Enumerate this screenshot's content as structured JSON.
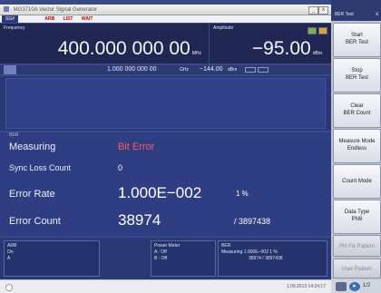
{
  "window": {
    "title": "MG3710A  Vector Signal Generator",
    "min": "_",
    "close": "x"
  },
  "status_bar": {
    "mode": "SG#",
    "flags": [
      "ARB",
      "LIST",
      "WAIT"
    ]
  },
  "frequency": {
    "label": "Frequency",
    "value": "400.000 000 00",
    "unit": "MHz"
  },
  "amplitude": {
    "label": "Amplitude",
    "value": "−95.00",
    "unit": "dBm"
  },
  "sub_line": {
    "value": "1.000 000 000 00",
    "unit": "GHz",
    "level": "−144.00",
    "level_unit": "dBm"
  },
  "ber": {
    "tag": "BER",
    "measuring_label": "Measuring",
    "measuring_value": "Bit Error",
    "sync_label": "Sync Loss Count",
    "sync_value": "0",
    "rate_label": "Error Rate",
    "rate_value": "1.000E−002",
    "rate_pct": "1 %",
    "count_label": "Error Count",
    "count_value": "38974",
    "count_total": "/  3897438"
  },
  "bottom": {
    "arb": {
      "title": "ARB",
      "l1": "On",
      "l2": "A"
    },
    "power_meter": {
      "title": "Power Meter",
      "l1": "A  :  Off",
      "l2": "B  :  Off"
    },
    "ber_summary": {
      "title": "BER",
      "l1": "Measuring   1.000E−002     1 %",
      "l2": "38974      /  3897438"
    },
    "time": "1.09.2013 14:24:17"
  },
  "side_panel": {
    "title": "BER Test",
    "close": "x",
    "buttons": [
      {
        "label": "Start",
        "sub": "BER Test"
      },
      {
        "label": "Stop",
        "sub": "BER Test"
      },
      {
        "label": "Clear",
        "sub": "BER Count"
      },
      {
        "label": "Measure Mode",
        "sub": "Endless"
      },
      {
        "label": "Count Mode",
        "sub": ""
      },
      {
        "label": "Data Type",
        "sub": "PN9"
      },
      {
        "label": "PN Fix Pattern",
        "sub": ""
      },
      {
        "label": "User Pattern",
        "sub": ""
      }
    ],
    "footer_label": "1/2"
  },
  "colors": {
    "panel_bg": "#3a4a86",
    "value_panel": "#1f2752",
    "accent_red": "#ff5a5a",
    "arrow_green": "#1fb58a"
  }
}
